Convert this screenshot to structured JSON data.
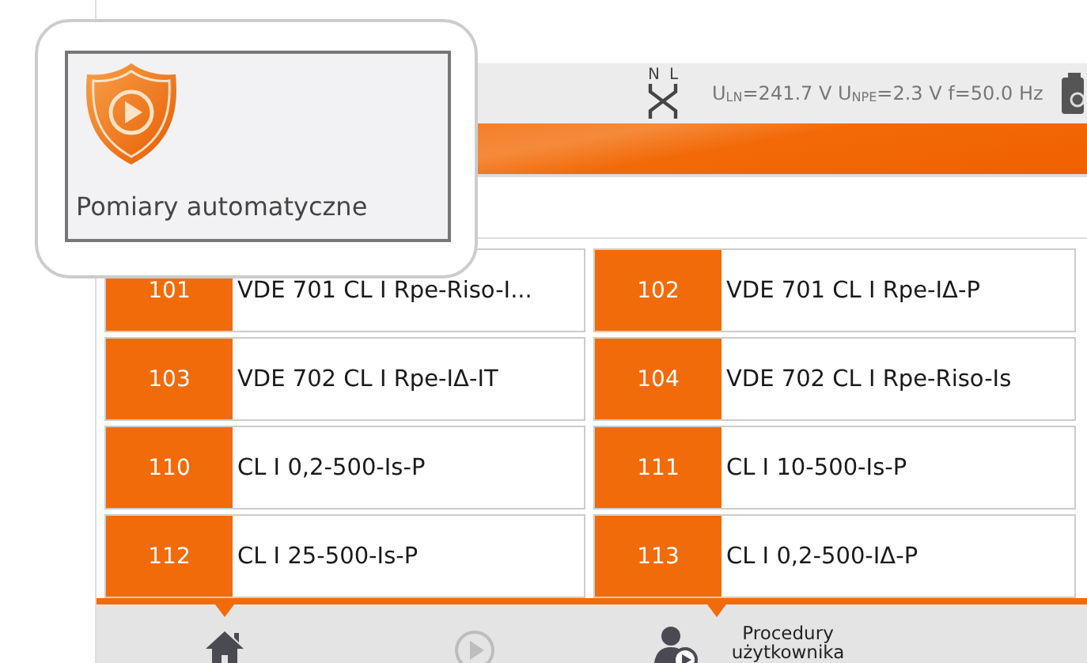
{
  "status_bar": {
    "wiring_labels": [
      "N",
      "L"
    ],
    "reading": "U$_{LN}$=241.7 V U$_{NPE}$=2.3 V f=50.0 Hz"
  },
  "procedures": [
    {
      "number": "101",
      "name": "VDE 701 CL I Rpe-Riso-I..."
    },
    {
      "number": "102",
      "name": "VDE 701 CL I Rpe-IΔ-P"
    },
    {
      "number": "103",
      "name": "VDE 702 CL I Rpe-IΔ-IT"
    },
    {
      "number": "104",
      "name": "VDE 702 CL I Rpe-Riso-Is"
    },
    {
      "number": "110",
      "name": "CL I 0,2-500-Is-P"
    },
    {
      "number": "111",
      "name": "CL I 10-500-Is-P"
    },
    {
      "number": "112",
      "name": "CL I 25-500-Is-P"
    },
    {
      "number": "113",
      "name": "CL I 0,2-500-IΔ-P"
    }
  ],
  "bottom_nav": [
    {
      "kind": "home",
      "selected": true,
      "disabled": false
    },
    {
      "kind": "play",
      "selected": false,
      "disabled": true
    },
    {
      "kind": "user",
      "selected": true,
      "disabled": false,
      "label": "Procedury użytkownika"
    }
  ],
  "callout": {
    "label": "Pomiary automatyczne"
  }
}
